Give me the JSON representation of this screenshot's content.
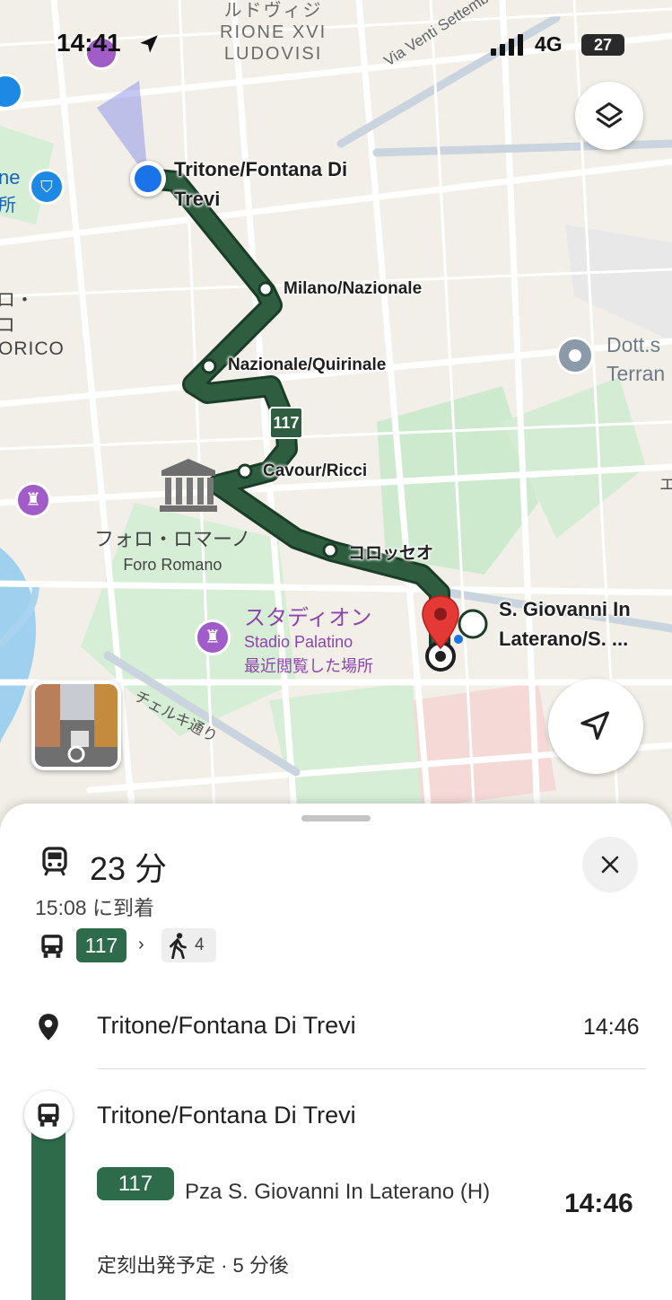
{
  "status_bar": {
    "time": "14:41",
    "network": "4G",
    "battery": "27"
  },
  "map": {
    "district": [
      "ルドヴィジ",
      "RIONE XVI",
      "LUDOVISI"
    ],
    "street_labels": [
      "Via Venti Settembre",
      "チェルキ通り"
    ],
    "left_edge_fragments": [
      "ne",
      "所",
      "ロ・",
      "コ",
      "ORICO"
    ],
    "poi_right": [
      "Dott.s",
      "Terran"
    ],
    "poi_right_edge": "エ",
    "forum": {
      "ja": "フォロ・ロマーノ",
      "it": "Foro Romano"
    },
    "stadio": {
      "ja": "スタディオン",
      "it": "Stadio Palatino",
      "note": "最近閲覧した場所"
    },
    "route_badge": "117",
    "stops": {
      "start": "Tritone/Fontana Di Trevi",
      "s1": "Milano/Nazionale",
      "s2": "Nazionale/Quirinale",
      "s3": "Cavour/Ricci",
      "s4": "コロッセオ",
      "end": "S. Giovanni In Laterano/S. ..."
    },
    "colors": {
      "route": "#2e5e3f",
      "pin": "#e53935",
      "location": "#1a73e8"
    }
  },
  "summary": {
    "duration": "23 分",
    "arrival": "15:08 に到着",
    "route_number": "117",
    "walk_minutes": "4"
  },
  "itinerary": {
    "origin": {
      "name": "Tritone/Fontana Di Trevi",
      "time": "14:46"
    },
    "board": {
      "stop": "Tritone/Fontana Di Trevi",
      "route": "117",
      "headsign": "Pza S. Giovanni In Laterano (H)",
      "departure": "14:46",
      "schedule": "定刻出発予定 · 5 分後"
    }
  }
}
